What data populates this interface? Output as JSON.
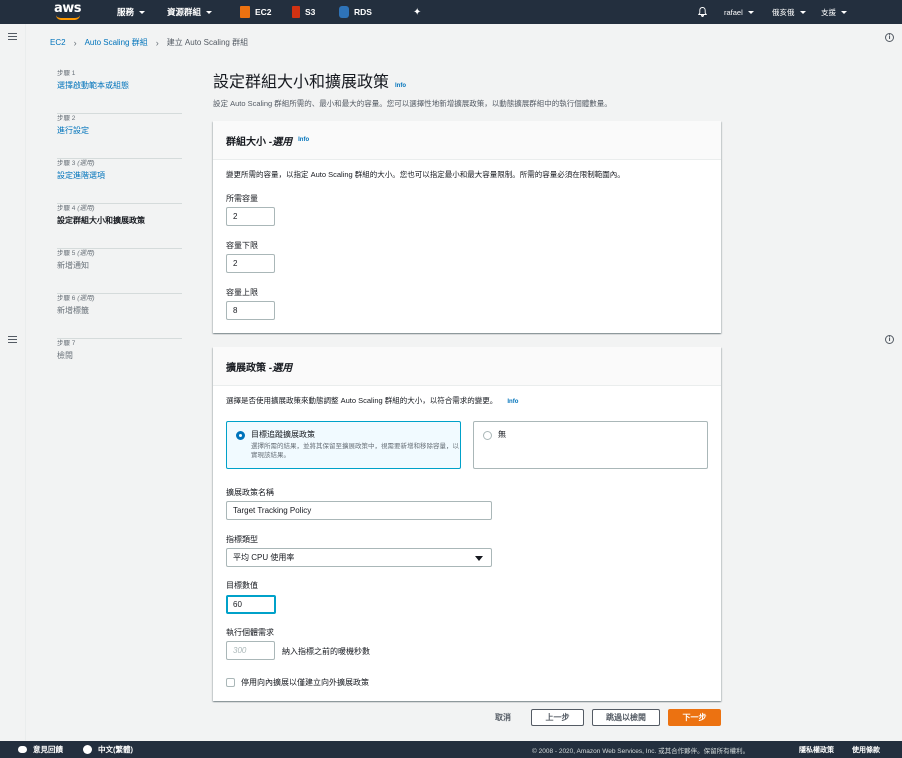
{
  "topnav": {
    "logo": "aws",
    "services": "服務",
    "resource_groups": "資源群組",
    "ec2": "EC2",
    "s3": "S3",
    "rds": "RDS",
    "user": "rafael",
    "region": "俄亥俄",
    "support": "支援",
    "colors": {
      "ec2": "#ec7211",
      "s3": "#d13212",
      "rds": "#2e73b8",
      "bg": "#232f3e"
    }
  },
  "breadcrumb": {
    "items": [
      "EC2",
      "Auto Scaling 群組"
    ],
    "current": "建立 Auto Scaling 群組"
  },
  "steps": [
    {
      "num": "步驟 1",
      "optional": "",
      "title": "選擇啟動範本或組態",
      "state": "link"
    },
    {
      "num": "步驟 2",
      "optional": "",
      "title": "進行設定",
      "state": "link"
    },
    {
      "num": "步驟 3",
      "optional": "(選用)",
      "title": "設定進階選項",
      "state": "link"
    },
    {
      "num": "步驟 4",
      "optional": "(選用)",
      "title": "設定群組大小和擴展政策",
      "state": "current"
    },
    {
      "num": "步驟 5",
      "optional": "(選用)",
      "title": "新增通知",
      "state": "disabled"
    },
    {
      "num": "步驟 6",
      "optional": "(選用)",
      "title": "新增標籤",
      "state": "disabled"
    },
    {
      "num": "步驟 7",
      "optional": "",
      "title": "檢閱",
      "state": "disabled"
    }
  ],
  "page": {
    "title": "設定群組大小和擴展政策",
    "info": "Info",
    "description": "設定 Auto Scaling 群組所需的、最小和最大的容量。您可以選擇性地新增擴展政策，以動態擴展群組中的執行個體數量。"
  },
  "group_size": {
    "header": "群組大小 - ",
    "header_optional": "選用",
    "info": "Info",
    "description": "變更所需的容量，以指定 Auto Scaling 群組的大小。您也可以指定最小和最大容量限制。所需的容量必須在限制範圍內。",
    "desired_label": "所需容量",
    "desired_value": "2",
    "min_label": "容量下限",
    "min_value": "2",
    "max_label": "容量上限",
    "max_value": "8"
  },
  "scaling": {
    "header": "擴展政策 - ",
    "header_optional": "選用",
    "description": "選擇是否使用擴展政策來動態調整 Auto Scaling 群組的大小，以符合需求的變更。",
    "info": "Info",
    "option_target": {
      "title": "目標追蹤擴展政策",
      "subtitle": "選擇所需的結果，並將其保留至擴展政策中，視需要新增和移除容量，以實現該結果。",
      "selected": true
    },
    "option_none": {
      "title": "無",
      "selected": false
    },
    "policy_name_label": "擴展政策名稱",
    "policy_name_value": "Target Tracking Policy",
    "metric_type_label": "指標類型",
    "metric_type_value": "平均 CPU 使用率",
    "target_value_label": "目標數值",
    "target_value": "60",
    "instance_needs_label": "執行個體需求",
    "warmup_placeholder": "300",
    "warmup_suffix": "納入指標之前的暖機秒數",
    "disable_scale_in_label": "停用向內擴展以僅建立向外擴展政策",
    "disable_scale_in_checked": false
  },
  "actions": {
    "cancel": "取消",
    "previous": "上一步",
    "skip": "跳過以檢閱",
    "next": "下一步"
  },
  "footer": {
    "feedback": "意見回饋",
    "language": "中文(繁體)",
    "copyright": "© 2008 - 2020, Amazon Web Services, Inc. 或其合作夥伴。保留所有權利。",
    "privacy": "隱私權政策",
    "terms": "使用條款"
  }
}
